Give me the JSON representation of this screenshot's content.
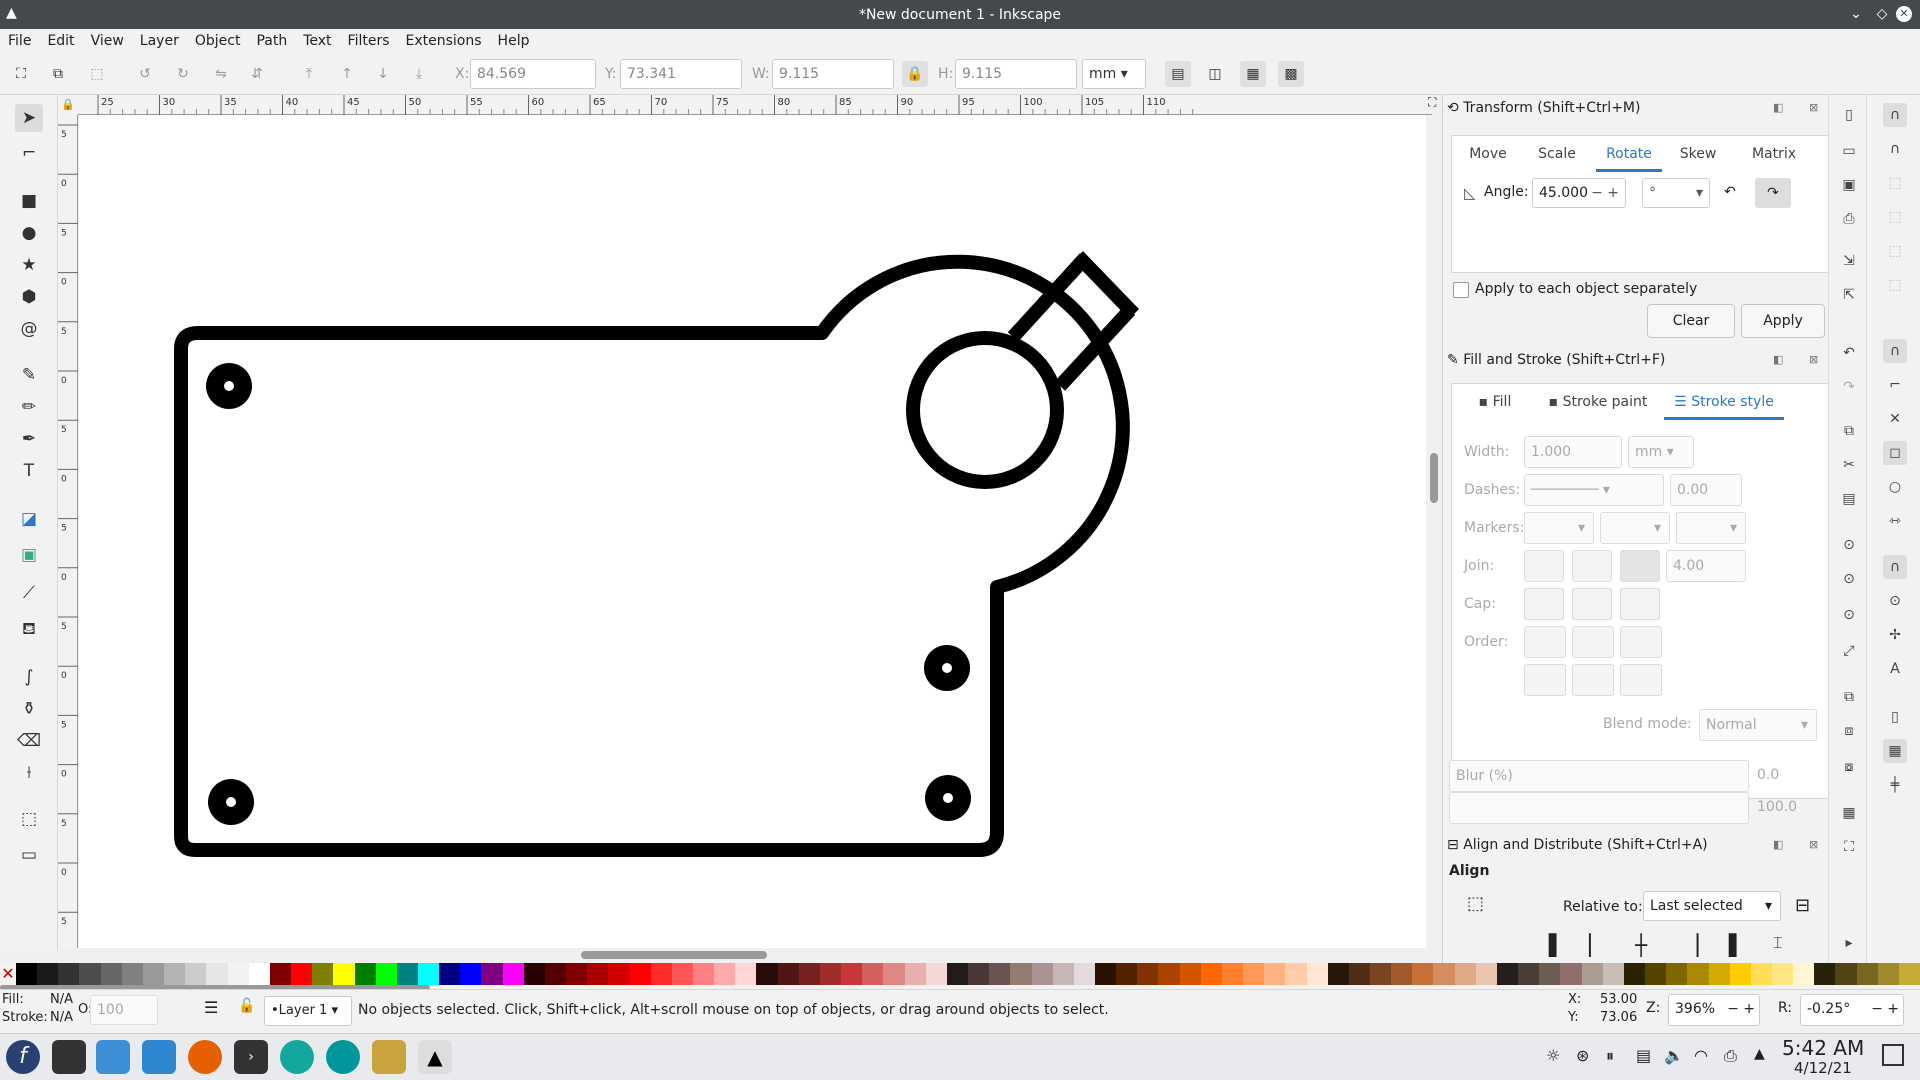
{
  "window": {
    "title": "*New document 1 - Inkscape"
  },
  "menu": [
    "File",
    "Edit",
    "View",
    "Layer",
    "Object",
    "Path",
    "Text",
    "Filters",
    "Extensions",
    "Help"
  ],
  "toolctrl": {
    "x_label": "X:",
    "x_value": "84.569",
    "y_label": "Y:",
    "y_value": "73.341",
    "w_label": "W:",
    "w_value": "9.115",
    "h_label": "H:",
    "h_value": "9.115",
    "unit": "mm"
  },
  "ruler_top_labels": [
    "25",
    "30",
    "35",
    "40",
    "45",
    "50",
    "55",
    "60",
    "65",
    "70",
    "75",
    "80",
    "85",
    "90",
    "95",
    "100",
    "105",
    "110"
  ],
  "ruler_left_labels": [
    "5",
    "0",
    "5",
    "0",
    "5",
    "0",
    "5",
    "0",
    "5",
    "0",
    "5",
    "0",
    "5",
    "0",
    "5",
    "0",
    "5"
  ],
  "transform": {
    "title": "Transform (Shift+Ctrl+M)",
    "tabs": [
      "Move",
      "Scale",
      "Rotate",
      "Skew",
      "Matrix"
    ],
    "angle_label": "Angle:",
    "angle_value": "45.000",
    "angle_unit": "°",
    "apply_each": "Apply to each object separately",
    "clear": "Clear",
    "apply": "Apply"
  },
  "fill_stroke": {
    "title": "Fill and Stroke (Shift+Ctrl+F)",
    "tabs": [
      "Fill",
      "Stroke paint",
      "Stroke style"
    ],
    "width_label": "Width:",
    "width_value": "1.000",
    "width_unit": "mm",
    "dashes_label": "Dashes:",
    "dashes_value": "0.00",
    "markers_label": "Markers:",
    "join_label": "Join:",
    "join_value": "4.00",
    "cap_label": "Cap:",
    "order_label": "Order:",
    "blend_label": "Blend mode:",
    "blend_value": "Normal",
    "blur_label": "Blur (%)",
    "blur_value": "0.0",
    "opacity_value": "100.0"
  },
  "align": {
    "title": "Align and Distribute (Shift+Ctrl+A)",
    "heading": "Align",
    "relative_label": "Relative to:",
    "relative_value": "Last selected"
  },
  "status": {
    "fill_label": "Fill:",
    "fill_value": "N/A",
    "stroke_label": "Stroke:",
    "stroke_value": "N/A",
    "opacity_label": "O:",
    "opacity_value": "100",
    "layer": "•Layer 1",
    "message": "No objects selected. Click, Shift+click, Alt+scroll mouse on top of objects, or drag around objects to select.",
    "cx_label": "X:",
    "cx_value": "53.00",
    "cy_label": "Y:",
    "cy_value": "73.06",
    "zoom_label": "Z:",
    "zoom_value": "396%",
    "rot_label": "R:",
    "rot_value": "-0.25°"
  },
  "taskbar": {
    "time": "5:42 AM",
    "date": "4/12/21"
  },
  "palette": [
    "#000000",
    "#1a1a1a",
    "#333333",
    "#4d4d4d",
    "#666666",
    "#808080",
    "#999999",
    "#b3b3b3",
    "#cccccc",
    "#e6e6e6",
    "#f2f2f2",
    "#ffffff",
    "#800000",
    "#ff0000",
    "#808000",
    "#ffff00",
    "#008000",
    "#00ff00",
    "#008080",
    "#00ffff",
    "#000080",
    "#0000ff",
    "#800080",
    "#ff00ff",
    "#2b0000",
    "#550000",
    "#800000",
    "#aa0000",
    "#d40000",
    "#ff0000",
    "#ff2a2a",
    "#ff5555",
    "#ff8080",
    "#ffaaaa",
    "#ffd5d5",
    "#280b0b",
    "#501616",
    "#782121",
    "#a02c2c",
    "#c83737",
    "#d35f5f",
    "#de8787",
    "#e9afaf",
    "#f4d7d7",
    "#241c1c",
    "#483737",
    "#6c5353",
    "#917c6f",
    "#ac9393",
    "#c8b7b7",
    "#e3dbdb",
    "#2b1100",
    "#552200",
    "#803300",
    "#aa4400",
    "#d45500",
    "#ff6600",
    "#ff7f2a",
    "#ff9955",
    "#ffb380",
    "#ffccaa",
    "#ffe6d5",
    "#28170b",
    "#502d16",
    "#784421",
    "#a05a2c",
    "#c87137",
    "#d38d5f",
    "#deaa87",
    "#e9c6af",
    "#241f1c",
    "#483e37",
    "#6c5d53",
    "#916f6f",
    "#ac9d93",
    "#c8beb7",
    "#2b2200",
    "#554400",
    "#806600",
    "#aa8800",
    "#d4aa00",
    "#ffcc00",
    "#ffdd55",
    "#ffe680",
    "#fff6d5",
    "#28220b",
    "#504416",
    "#786721",
    "#a0892c",
    "#c8ab37"
  ]
}
